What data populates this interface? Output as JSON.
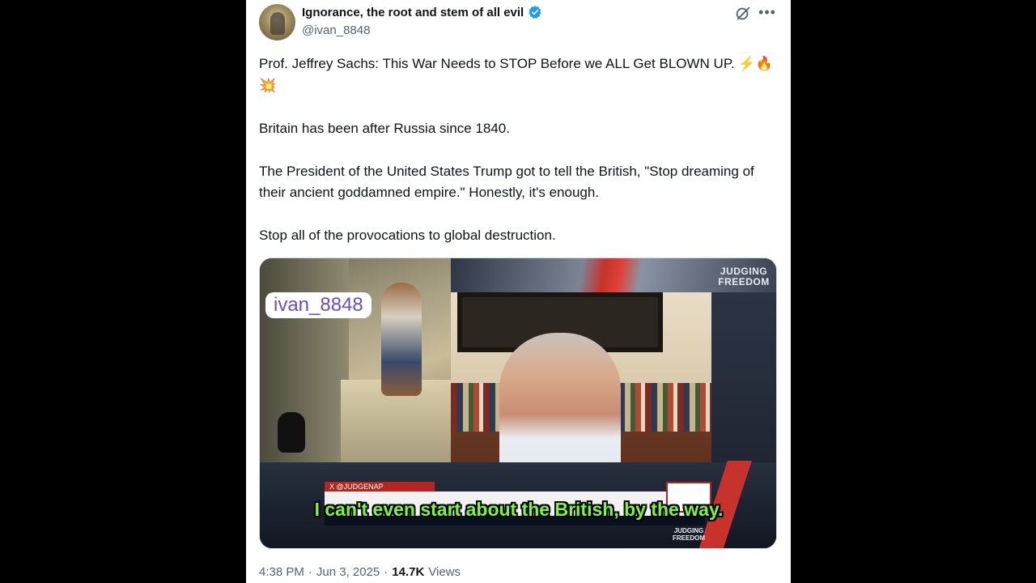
{
  "post": {
    "display_name": "Ignorance, the root and stem of all evil",
    "handle": "@ivan_8848",
    "verified_icon": "verified-badge-icon",
    "paragraphs": [
      "Prof. Jeffrey Sachs: This War Needs to STOP Before we ALL Get BLOWN UP. ⚡🔥💥",
      "Britain has been after Russia since 1840.",
      "The President of the United States Trump got to tell the British, \"Stop dreaming of their ancient goddamned empire.\" Honestly, it's enough.",
      "Stop all of the provocations to global destruction."
    ],
    "time": "4:38 PM",
    "date": "Jun 3, 2025",
    "views_count": "14.7K",
    "views_label": "Views"
  },
  "video": {
    "watermark": "ivan_8848",
    "brand": "JUDGING FREEDOM",
    "lower_third_tag": "X @JUDGENAP",
    "caption": "I can't even start about the British, by the way."
  },
  "colors": {
    "verified": "#1d9bf0",
    "text": "#0f1419",
    "secondary": "#536471",
    "caption": "#7df73d"
  }
}
